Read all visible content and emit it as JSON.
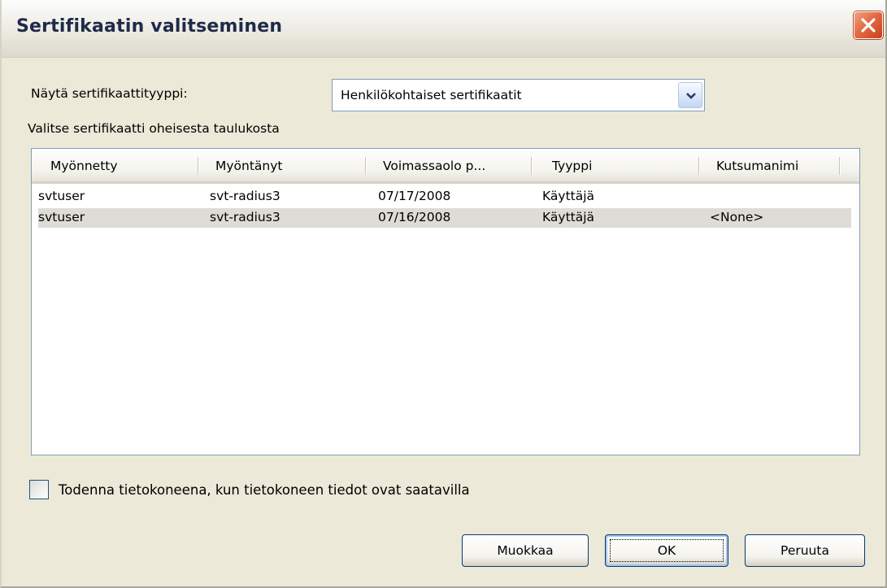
{
  "window": {
    "title": "Sertifikaatin valitseminen"
  },
  "cert_type": {
    "label": "Näytä sertifikaattityyppi:",
    "selected": "Henkilökohtaiset sertifikaatit"
  },
  "instruction": "Valitse sertifikaatti oheisesta taulukosta",
  "table": {
    "columns": [
      "Myönnetty",
      "Myöntänyt",
      "Voimassaolo p...",
      "Tyyppi",
      "Kutsumanimi"
    ],
    "rows": [
      {
        "issued_to": "svtuser",
        "issued_by": "svt-radius3",
        "expiry": "07/17/2008",
        "type": "Käyttäjä",
        "friendly_name": ""
      },
      {
        "issued_to": "svtuser",
        "issued_by": "svt-radius3",
        "expiry": "07/16/2008",
        "type": "Käyttäjä",
        "friendly_name": "<None>"
      }
    ]
  },
  "checkbox": {
    "label": "Todenna tietokoneena, kun tietokoneen tiedot ovat saatavilla",
    "checked": false
  },
  "buttons": {
    "edit": "Muokkaa",
    "ok": "OK",
    "cancel": "Peruuta"
  },
  "icons": {
    "close": "close-icon",
    "dropdown": "chevron-down-icon"
  },
  "colors": {
    "window_bg": "#ece9d8",
    "close_button": "#e36a45",
    "border": "#7f9db9"
  }
}
